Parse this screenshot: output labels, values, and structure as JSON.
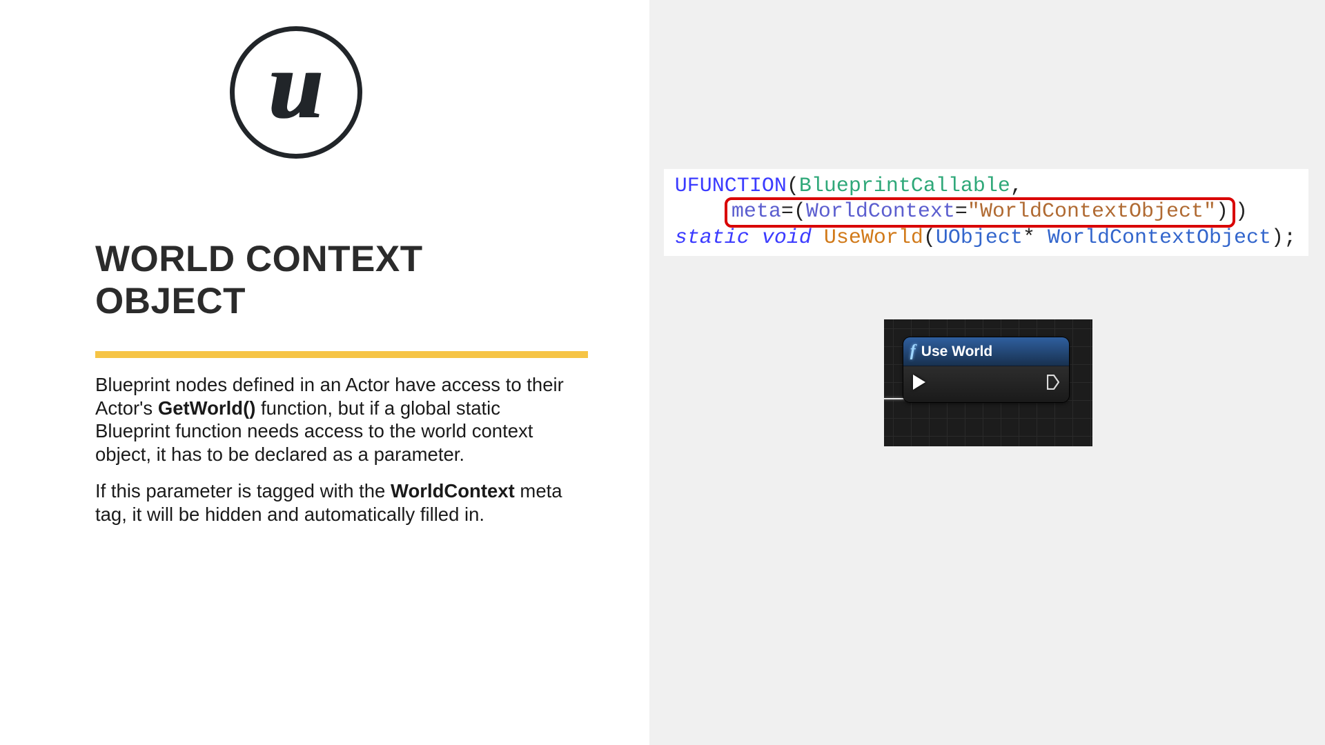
{
  "heading": "WORLD CONTEXT OBJECT",
  "paragraphs": {
    "p1": {
      "t1": "Blueprint nodes defined in an Actor have access to their Actor's ",
      "b1": "GetWorld()",
      "t2": " function, but if a global static Blueprint function needs access to the world context object, it has to be declared as a parameter."
    },
    "p2": {
      "t1": "If this parameter is tagged with the ",
      "b1": "WorldContext",
      "t2": " meta tag, it will be hidden and automatically filled in."
    }
  },
  "code": {
    "ufunction": "UFUNCTION",
    "open_paren": "(",
    "callable": "BlueprintCallable",
    "comma": ",",
    "indent": "    ",
    "meta": "meta",
    "equals": "=",
    "wc_key": "WorldContext",
    "eq2": "=",
    "quote": "\"",
    "wc_val": "WorldContextObject",
    "close_paren_inner": ")",
    "close_paren_outer": ")",
    "static": "static",
    "void_kw": "void",
    "func": "UseWorld",
    "type": "UObject",
    "star": "*",
    "arg": "WorldContextObject",
    "semi": ";"
  },
  "node": {
    "title": "Use World",
    "f": "f"
  }
}
